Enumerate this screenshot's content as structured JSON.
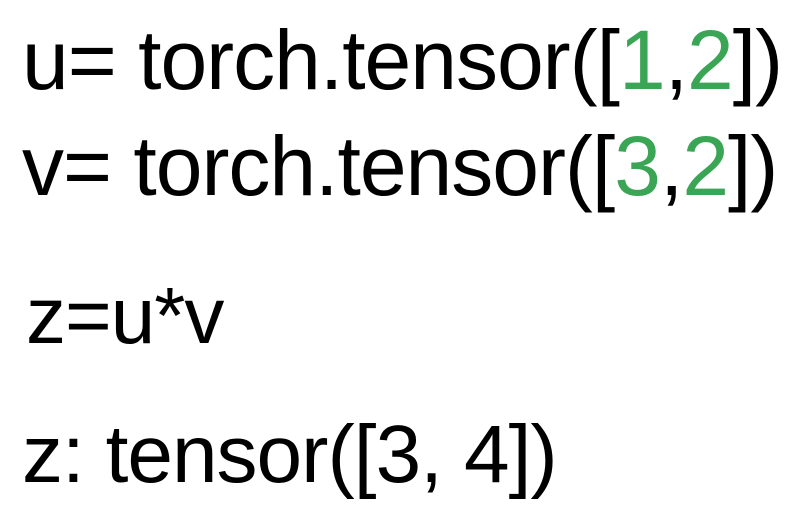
{
  "lines": [
    {
      "prefix": "u= torch.tensor([",
      "values": [
        "1",
        "2"
      ],
      "separator": ",",
      "suffix": "])"
    },
    {
      "prefix": "v= torch.tensor([",
      "values": [
        "3",
        "2"
      ],
      "separator": ",",
      "suffix": "])"
    },
    {
      "text": "z=u*v"
    },
    {
      "prefix": "z: tensor([",
      "values": [
        "3",
        "4"
      ],
      "separator": ",",
      "suffix": "])"
    }
  ],
  "colors": {
    "text": "#000000",
    "highlight": "#3aa655",
    "background": "#ffffff"
  }
}
